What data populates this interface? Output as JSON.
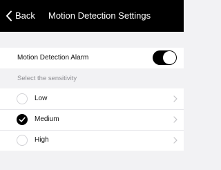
{
  "nav": {
    "back_label": "Back",
    "title": "Motion Detection Settings"
  },
  "alarm": {
    "label": "Motion Detection Alarm",
    "enabled": true
  },
  "sensitivity": {
    "header": "Select the sensitivity",
    "selected": "Medium",
    "options": [
      {
        "label": "Low",
        "checked": false
      },
      {
        "label": "Medium",
        "checked": true
      },
      {
        "label": "High",
        "checked": false
      }
    ]
  },
  "icons": {
    "back": "chevron-left-icon",
    "row_chevron": "chevron-right-icon",
    "check": "checkmark-icon"
  },
  "colors": {
    "nav_background": "#000000",
    "toggle_on": "#000000",
    "radio_selected": "#000000",
    "page_background": "#f2f2f4",
    "secondary_text": "#8e8e93"
  }
}
